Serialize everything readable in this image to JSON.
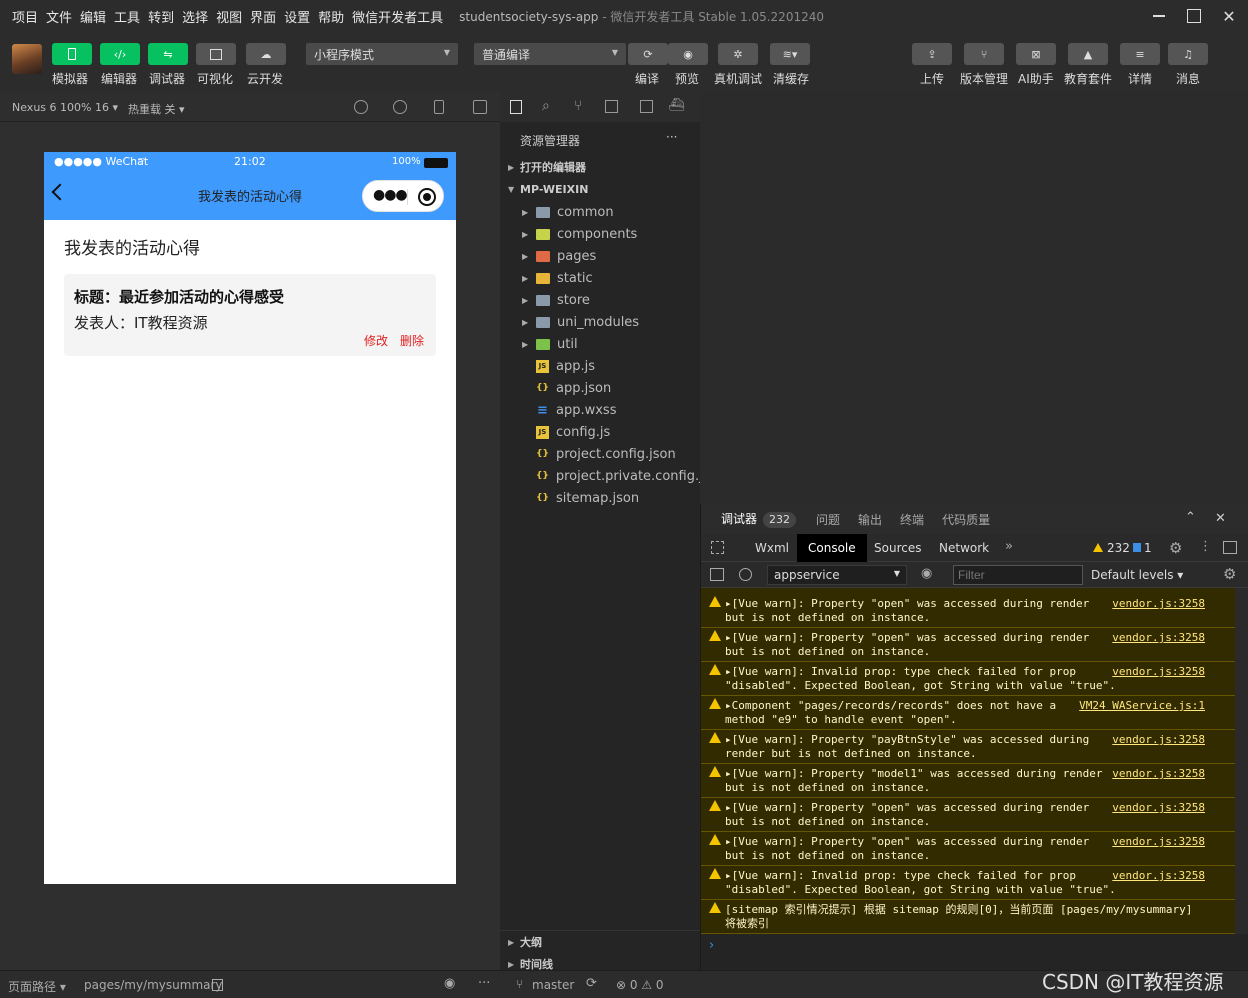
{
  "menu": [
    "项目",
    "文件",
    "编辑",
    "工具",
    "转到",
    "选择",
    "视图",
    "界面",
    "设置",
    "帮助",
    "微信开发者工具"
  ],
  "window_title": "studentsociety-sys-app",
  "window_subtitle": "- 微信开发者工具 Stable 1.05.2201240",
  "toolbar": {
    "left_buttons": [
      "模拟器",
      "编辑器",
      "调试器",
      "可视化",
      "云开发"
    ],
    "mode_select": "小程序模式",
    "compile_select": "普通编译",
    "mid_buttons": [
      "编译",
      "预览",
      "真机调试",
      "清缓存"
    ],
    "right_buttons": [
      "上传",
      "版本管理",
      "AI助手",
      "教育套件",
      "详情",
      "消息"
    ]
  },
  "sim_bar": {
    "device": "Nexus 6 100% 16 ▾",
    "hot_reload": "热重载 关 ▾"
  },
  "phone": {
    "carrier": "●●●●● WeChat",
    "time": "21:02",
    "battery": "100%",
    "nav_title": "我发表的活动心得",
    "page_heading": "我发表的活动心得",
    "card": {
      "title": "标题：最近参加活动的心得感受",
      "author": "发表人：IT教程资源",
      "edit": "修改",
      "delete": "删除"
    }
  },
  "explorer": {
    "title": "资源管理器",
    "more": "···",
    "open_editors": "打开的编辑器",
    "root": "MP-WEIXIN",
    "folders": [
      {
        "name": "common",
        "color": "#8a9aa8"
      },
      {
        "name": "components",
        "color": "#c5d44a"
      },
      {
        "name": "pages",
        "color": "#e06a45"
      },
      {
        "name": "static",
        "color": "#e8b43a"
      },
      {
        "name": "store",
        "color": "#8a9aa8"
      },
      {
        "name": "uni_modules",
        "color": "#8a9aa8"
      },
      {
        "name": "util",
        "color": "#7cc14a"
      }
    ],
    "files": [
      {
        "name": "app.js",
        "icon": "JS",
        "color": "#e8c43a"
      },
      {
        "name": "app.json",
        "icon": "{..}",
        "color": "#e8c43a"
      },
      {
        "name": "app.wxss",
        "icon": "≡",
        "color": "#3c8ee6"
      },
      {
        "name": "config.js",
        "icon": "JS",
        "color": "#e8c43a"
      },
      {
        "name": "project.config.json",
        "icon": "{..}",
        "color": "#e8c43a"
      },
      {
        "name": "project.private.config.js...",
        "icon": "{..}",
        "color": "#e8c43a"
      },
      {
        "name": "sitemap.json",
        "icon": "{..}",
        "color": "#e8c43a"
      }
    ],
    "outline": "大纲",
    "timeline": "时间线"
  },
  "devtools": {
    "tabs": [
      "调试器",
      "问题",
      "输出",
      "终端",
      "代码质量"
    ],
    "badge": "232",
    "panels": [
      "Wxml",
      "Console",
      "Sources",
      "Network"
    ],
    "active_panel": "Console",
    "warn_count": "232",
    "info_count": "1",
    "context": "appservice",
    "filter_placeholder": "Filter",
    "levels": "Default levels ▾",
    "logs": [
      {
        "msg": "▸[Vue warn]: Property \"open\" was accessed during render\nbut is not defined on instance.",
        "src": "vendor.js:3258"
      },
      {
        "msg": "▸[Vue warn]: Property \"open\" was accessed during render\nbut is not defined on instance.",
        "src": "vendor.js:3258"
      },
      {
        "msg": "▸[Vue warn]: Invalid prop: type check failed for prop\n\"disabled\". Expected Boolean, got String with value \"true\".",
        "src": "vendor.js:3258"
      },
      {
        "msg": "▸Component \"pages/records/records\" does not have a\nmethod \"e9\" to handle event \"open\".",
        "src": "VM24 WAService.js:1"
      },
      {
        "msg": "▸[Vue warn]: Property \"payBtnStyle\" was accessed during\nrender but is not defined on instance.",
        "src": "vendor.js:3258"
      },
      {
        "msg": "▸[Vue warn]: Property \"model1\" was accessed during render\nbut is not defined on instance.",
        "src": "vendor.js:3258"
      },
      {
        "msg": "▸[Vue warn]: Property \"open\" was accessed during render\nbut is not defined on instance.",
        "src": "vendor.js:3258"
      },
      {
        "msg": "▸[Vue warn]: Property \"open\" was accessed during render\nbut is not defined on instance.",
        "src": "vendor.js:3258"
      },
      {
        "msg": "▸[Vue warn]: Invalid prop: type check failed for prop\n\"disabled\". Expected Boolean, got String with value \"true\".",
        "src": "vendor.js:3258"
      },
      {
        "msg": "[sitemap 索引情况提示] 根据 sitemap 的规则[0]，当前页面 [pages/my/mysummary]\n将被索引",
        "src": ""
      }
    ]
  },
  "bottom": {
    "page_path_label": "页面路径 ▾",
    "page_path": "pages/my/mysummary",
    "branch": "master",
    "errors": "⊗ 0 ⚠ 0"
  },
  "watermark": "CSDN @IT教程资源",
  "colors": {
    "accent_green": "#07c160",
    "nav_blue": "#3f9afd",
    "danger": "#e02020",
    "warn_bg": "#332b00"
  }
}
